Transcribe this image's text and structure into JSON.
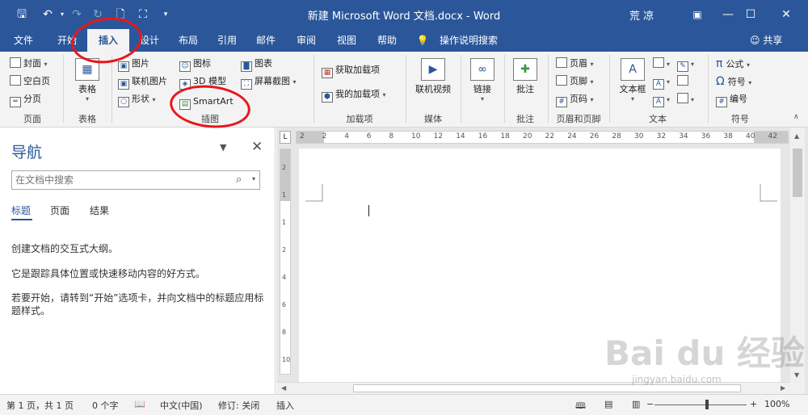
{
  "titlebar": {
    "doc_title": "新建 Microsoft Word 文档.docx - Word",
    "user": "荒 凉",
    "icons": [
      "save-icon",
      "undo-icon",
      "redo-icon",
      "repeat-icon",
      "new-doc-icon",
      "screenshot-icon",
      "qat-customize-icon"
    ],
    "window_buttons": [
      "ribbon-display-icon",
      "minimize-icon",
      "maximize-icon",
      "close-icon"
    ]
  },
  "tabs": [
    {
      "id": "file",
      "label": "文件"
    },
    {
      "id": "home",
      "label": "开始"
    },
    {
      "id": "insert",
      "label": "插入"
    },
    {
      "id": "design",
      "label": "设计"
    },
    {
      "id": "layout",
      "label": "布局"
    },
    {
      "id": "references",
      "label": "引用"
    },
    {
      "id": "mailings",
      "label": "邮件"
    },
    {
      "id": "review",
      "label": "审阅"
    },
    {
      "id": "view",
      "label": "视图"
    },
    {
      "id": "help",
      "label": "帮助"
    },
    {
      "id": "tellme",
      "label": "操作说明搜索"
    }
  ],
  "share": "共享",
  "ribbon": {
    "pages": {
      "label": "页面",
      "cover": "封面",
      "blank": "空白页",
      "break": "分页"
    },
    "tables": {
      "label": "表格",
      "table": "表格"
    },
    "illustrations": {
      "label": "插图",
      "pictures": "图片",
      "online_pictures": "联机图片",
      "shapes": "形状",
      "icons": "图标",
      "model3d": "3D 模型",
      "smartart": "SmartArt",
      "chart": "图表",
      "screenshot": "屏幕截图"
    },
    "addins": {
      "label": "加载项",
      "get": "获取加载项",
      "my": "我的加载项"
    },
    "media": {
      "label": "媒体",
      "video": "联机视频"
    },
    "links": {
      "label": "链接"
    },
    "comments": {
      "label": "批注",
      "comment": "批注"
    },
    "header_footer": {
      "label": "页眉和页脚",
      "header": "页眉",
      "footer": "页脚",
      "page_number": "页码"
    },
    "text": {
      "label": "文本",
      "textbox": "文本框"
    },
    "symbols": {
      "label": "符号",
      "equation": "公式",
      "symbol": "符号",
      "number": "编号"
    }
  },
  "nav": {
    "title": "导航",
    "search_placeholder": "在文档中搜索",
    "tabs": [
      "标题",
      "页面",
      "结果"
    ],
    "para1": "创建文档的交互式大纲。",
    "para2": "它是跟踪具体位置或快速移动内容的好方式。",
    "para3": "若要开始，请转到“开始”选项卡，并向文档中的标题应用标题样式。"
  },
  "ruler": {
    "h_ticks": [
      "2",
      "2",
      "4",
      "6",
      "8",
      "10",
      "12",
      "14",
      "16",
      "18",
      "20",
      "22",
      "24",
      "26",
      "28",
      "30",
      "32",
      "34",
      "36",
      "38",
      "40",
      "42"
    ],
    "v_ticks": [
      "2",
      "1",
      "1",
      "2",
      "4",
      "6",
      "8",
      "10"
    ]
  },
  "status": {
    "page": "第 1 页，共 1 页",
    "words": "0 个字",
    "language": "中文(中国)",
    "track": "修订: 关闭",
    "mode": "插入",
    "zoom_percent": "100%",
    "zoom_level": 1.0
  },
  "watermark": {
    "main": "Bai du 经验",
    "url": "jingyan.baidu.com"
  },
  "colors": {
    "accent": "#2b579a",
    "ribbon_bg": "#f3f3f3",
    "annotation": "#e8161c"
  }
}
